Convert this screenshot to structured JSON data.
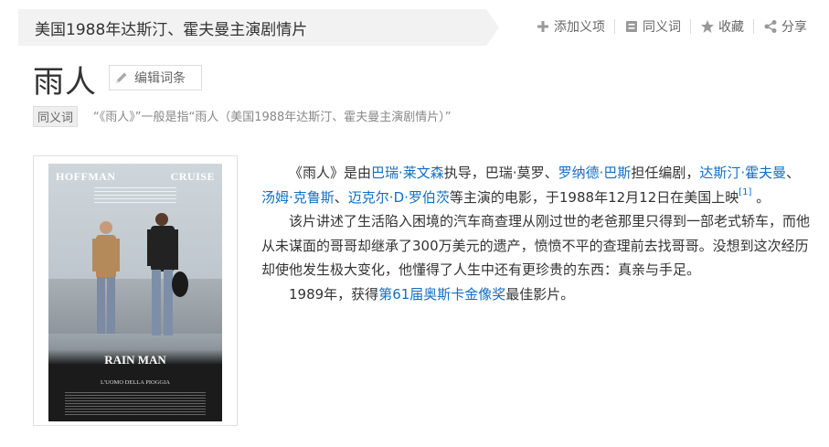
{
  "header": {
    "subtitle": "美国1988年达斯汀、霍夫曼主演剧情片",
    "actions": {
      "add_sense": "添加义项",
      "synonym": "同义词",
      "favorite": "收藏",
      "share": "分享"
    }
  },
  "title": "雨人",
  "edit_button": "编辑词条",
  "synonym_tag": "同义词",
  "synonym_text": "“《雨人》”一般是指“雨人（美国1988年达斯汀、霍夫曼主演剧情片）”",
  "poster": {
    "name_left": "HOFFMAN",
    "name_right": "CRUISE",
    "title": "RAIN MAN",
    "subtitle": "L'UOMO DELLA PIOGGIA"
  },
  "paragraph1": {
    "t1": "《雨人》是由",
    "director": "巴瑞·莱文森",
    "t2": "执导，巴瑞·莫罗、",
    "writer": "罗纳德·巴斯",
    "t3": "担任编剧，",
    "actor1": "达斯汀·霍夫曼",
    "t4": "、",
    "actor2": "汤姆·克鲁斯",
    "t5": "、",
    "actor3": "迈克尔·D·罗伯茨",
    "t6": "等主演的电影，于1988年12月12日在美国上映",
    "ref": "[1]",
    "t7": " 。"
  },
  "paragraph2": "该片讲述了生活陷入困境的汽车商查理从刚过世的老爸那里只得到一部老式轿车，而他从未谋面的哥哥却继承了300万美元的遗产，愤愤不平的查理前去找哥哥。没想到这次经历却使他发生极大变化，他懂得了人生中还有更珍贵的东西：真亲与手足。",
  "paragraph3": {
    "t1": "1989年，获得",
    "award": "第61届奥斯卡金像奖",
    "t2": "最佳影片。"
  }
}
